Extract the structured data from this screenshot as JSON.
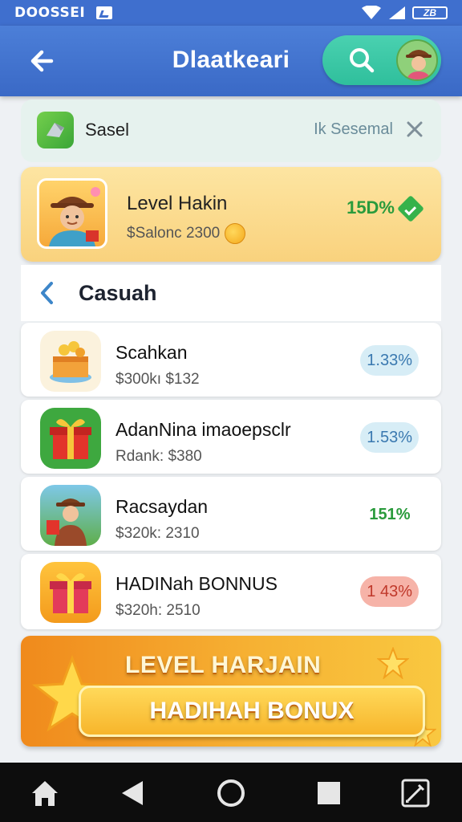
{
  "status_bar": {
    "carrier": "DOOSSEI",
    "battery": "ZB"
  },
  "header": {
    "title": "Dlaatkeari",
    "back_icon": "arrow-left-icon",
    "search_icon": "search-icon",
    "avatar": "avatar"
  },
  "filter": {
    "label": "Sasel",
    "action": "Ik Sesemal",
    "close_icon": "close-icon"
  },
  "featured": {
    "title": "Level Hakin",
    "subtitle": "$Salonc 2300",
    "percent": "15D%"
  },
  "section": {
    "title": "Casuah"
  },
  "items": [
    {
      "title": "Scahkan",
      "subtitle": "$300kı $132",
      "badge": "1.33%"
    },
    {
      "title": "AdanNina imaoepsclr",
      "subtitle": "Rdank: $380",
      "badge": "1.53%"
    },
    {
      "title": "Racsaydan",
      "subtitle": "$320k: 2310",
      "badge": "151%"
    },
    {
      "title": "HADINah BONNUS",
      "subtitle": "$320h: 2510",
      "badge": "1 43%"
    }
  ],
  "banner": {
    "top_text": "LEVEL HARJAIN",
    "button_label": "HADIHAH BONUX"
  },
  "colors": {
    "header_blue": "#3f6fce",
    "accent_green": "#2fbf9c",
    "featured_yellow": "#f9d27d",
    "banner_orange": "#f08a1c"
  }
}
